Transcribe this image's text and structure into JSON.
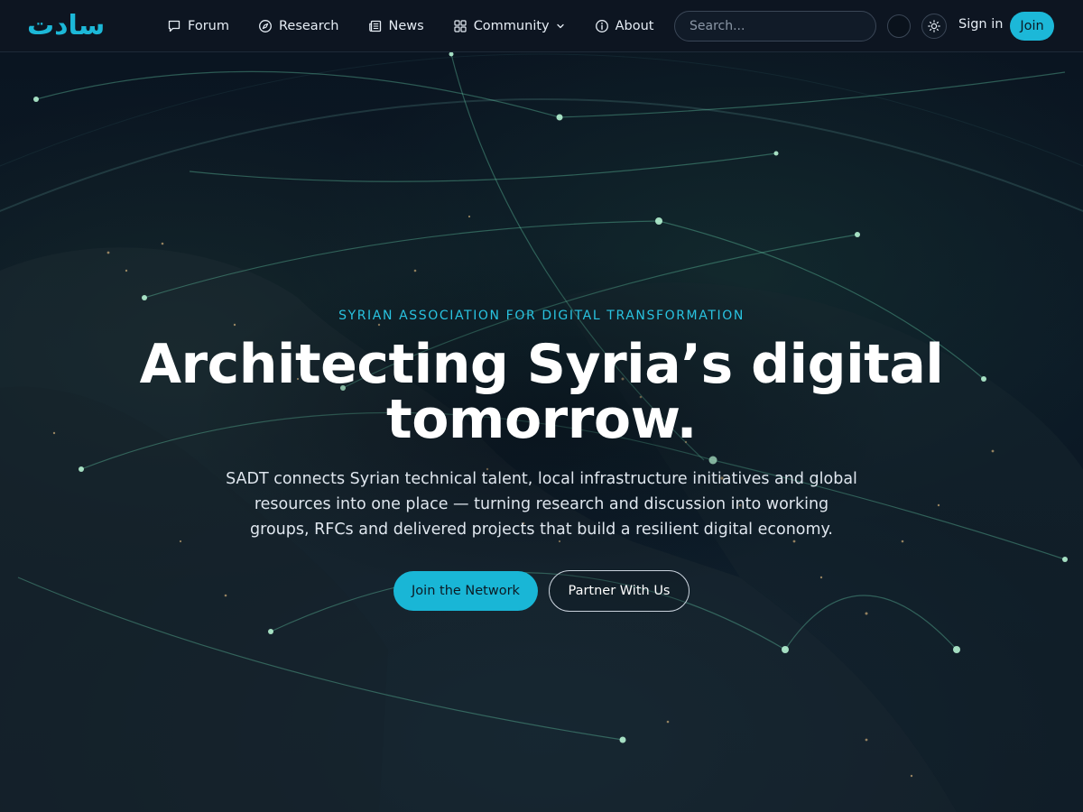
{
  "brand": {
    "logo_text": "سادت",
    "accent_color": "#1cb8d8"
  },
  "nav": {
    "items": [
      {
        "label": "Forum",
        "icon": "chat-bubble-icon"
      },
      {
        "label": "Research",
        "icon": "compass-icon"
      },
      {
        "label": "News",
        "icon": "newspaper-icon"
      },
      {
        "label": "Community",
        "icon": "grid-icon",
        "has_dropdown": true
      },
      {
        "label": "About",
        "icon": "info-icon"
      }
    ]
  },
  "header": {
    "search_placeholder": "Search...",
    "signin_label": "Sign in",
    "join_label": "Join"
  },
  "hero": {
    "eyebrow": "SYRIAN ASSOCIATION FOR DIGITAL TRANSFORMATION",
    "headline": "Architecting Syria’s digital tomorrow.",
    "subtext": "SADT connects Syrian technical talent, local infrastructure initiatives and global resources into one place — turning research and discussion into working groups, RFCs and delivered projects that build a resilient digital economy.",
    "primary_cta": "Join the Network",
    "secondary_cta": "Partner With Us",
    "background": "night-earth-network-map"
  }
}
